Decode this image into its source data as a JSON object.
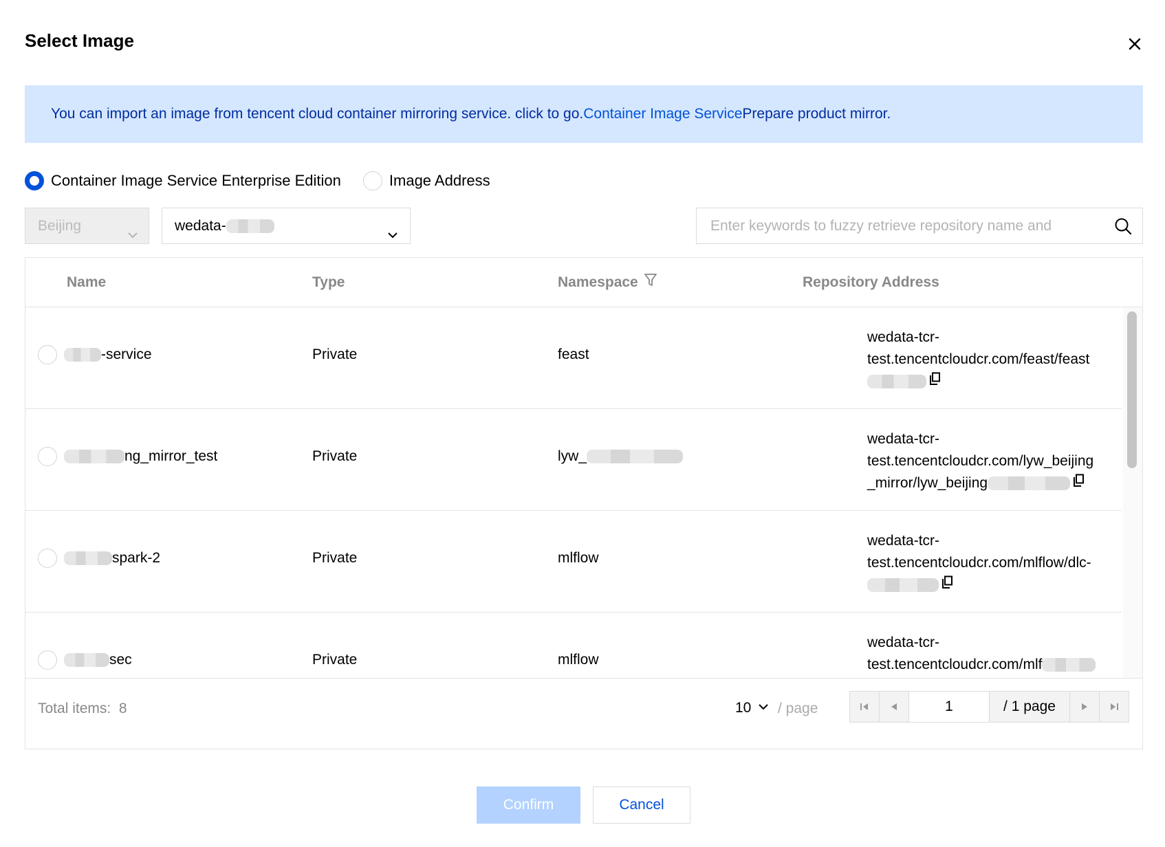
{
  "dialog": {
    "title": "Select Image"
  },
  "notice": {
    "text_before": "You can import an image from tencent cloud container mirroring service. click to go.",
    "link": "Container Image Service",
    "text_after": "Prepare product mirror."
  },
  "source": {
    "options": [
      "Container Image Service Enterprise Edition",
      "Image Address"
    ],
    "selected": "Container Image Service Enterprise Edition"
  },
  "filters": {
    "region": "Beijing",
    "instance": "wedata-",
    "search_placeholder": "Enter keywords to fuzzy retrieve repository name and"
  },
  "table": {
    "columns": {
      "name": "Name",
      "type": "Type",
      "namespace": "Namespace",
      "address": "Repository Address"
    },
    "rows": [
      {
        "name": "-service",
        "type": "Private",
        "namespace": "feast",
        "address_lines": [
          "wedata-tcr-",
          "test.tencentcloudcr.com/feast/feast"
        ]
      },
      {
        "name": "ng_mirror_test",
        "type": "Private",
        "namespace": "lyw_",
        "address_lines": [
          "wedata-tcr-",
          "test.tencentcloudcr.com/lyw_beijing",
          "_mirror/lyw_beijing"
        ]
      },
      {
        "name": "spark-2",
        "type": "Private",
        "namespace": "mlflow",
        "address_lines": [
          "wedata-tcr-",
          "test.tencentcloudcr.com/mlflow/dlc-"
        ]
      },
      {
        "name": "sec",
        "type": "Private",
        "namespace": "mlflow",
        "address_lines": [
          "wedata-tcr-",
          "test.tencentcloudcr.com/mlf"
        ]
      }
    ]
  },
  "pagination": {
    "total_label": "Total items:",
    "total": "8",
    "page_size": "10",
    "per_page_label": "/ page",
    "current_page": "1",
    "total_pages_label": "/ 1 page"
  },
  "footer": {
    "confirm": "Confirm",
    "cancel": "Cancel"
  },
  "colors": {
    "primary": "#0052d9",
    "notice_bg": "#d5e7ff",
    "confirm_disabled_bg": "#b3d2ff"
  }
}
